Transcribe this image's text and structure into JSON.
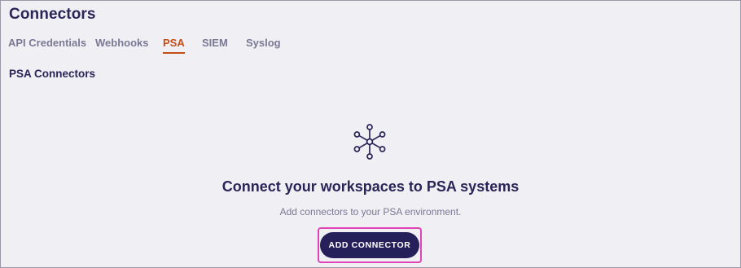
{
  "page": {
    "title": "Connectors"
  },
  "tabs": [
    {
      "label": "API Credentials",
      "active": false
    },
    {
      "label": "Webhooks",
      "active": false
    },
    {
      "label": "PSA",
      "active": true
    },
    {
      "label": "SIEM",
      "active": false
    },
    {
      "label": "Syslog",
      "active": false
    }
  ],
  "section": {
    "title": "PSA Connectors"
  },
  "empty_state": {
    "icon": "hub-network-icon",
    "heading": "Connect your workspaces to PSA systems",
    "subtext": "Add connectors to your PSA environment.",
    "button_label": "ADD CONNECTOR"
  },
  "colors": {
    "primary": "#25205a",
    "active_tab": "#c24f17",
    "highlight": "#e043b6",
    "background": "#f0eff4"
  }
}
